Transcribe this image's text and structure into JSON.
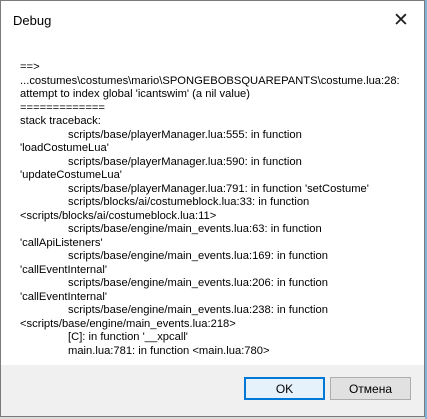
{
  "window": {
    "title": "Debug",
    "close_glyph": "✕"
  },
  "trace_lines": [
    {
      "text": "==>",
      "indent": false
    },
    {
      "text": "...costumes\\costumes\\mario\\SPONGEBOBSQUAREPANTS\\costume.lua:28:",
      "indent": false
    },
    {
      "text": "attempt to index global 'icantswim' (a nil value)",
      "indent": false
    },
    {
      "text": "=============",
      "indent": false
    },
    {
      "text": "stack traceback:",
      "indent": false
    },
    {
      "text": "scripts/base/playerManager.lua:555: in function",
      "indent": true
    },
    {
      "text": "'loadCostumeLua'",
      "indent": false
    },
    {
      "text": "scripts/base/playerManager.lua:590: in function",
      "indent": true
    },
    {
      "text": "'updateCostumeLua'",
      "indent": false
    },
    {
      "text": "scripts/base/playerManager.lua:791: in function 'setCostume'",
      "indent": true
    },
    {
      "text": "scripts/blocks/ai/costumeblock.lua:33: in function",
      "indent": true
    },
    {
      "text": "<scripts/blocks/ai/costumeblock.lua:11>",
      "indent": false
    },
    {
      "text": "scripts/base/engine/main_events.lua:63: in function",
      "indent": true
    },
    {
      "text": "'callApiListeners'",
      "indent": false
    },
    {
      "text": "scripts/base/engine/main_events.lua:169: in function",
      "indent": true
    },
    {
      "text": "'callEventInternal'",
      "indent": false
    },
    {
      "text": "scripts/base/engine/main_events.lua:206: in function",
      "indent": true
    },
    {
      "text": "'callEventInternal'",
      "indent": false
    },
    {
      "text": "scripts/base/engine/main_events.lua:238: in function",
      "indent": true
    },
    {
      "text": "<scripts/base/engine/main_events.lua:218>",
      "indent": false
    },
    {
      "text": "[C]: in function '__xpcall'",
      "indent": true
    },
    {
      "text": "main.lua:781: in function <main.lua:780>",
      "indent": true
    }
  ],
  "buttons": {
    "ok": "OK",
    "cancel": "Отмена"
  },
  "colors": {
    "accent": "#0078d7",
    "dialog_bg": "#f0f0f0",
    "content_bg": "#ffffff"
  },
  "icons": {
    "close": "close-icon"
  }
}
